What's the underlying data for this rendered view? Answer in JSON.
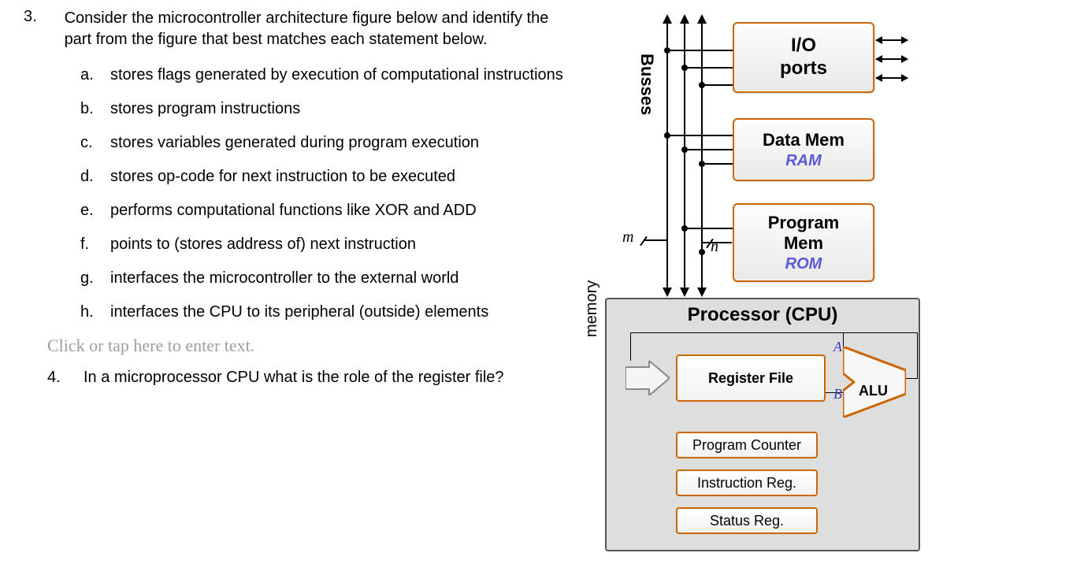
{
  "q3": {
    "number": "3.",
    "intro": "Consider the microcontroller architecture figure below and identify the part from the figure that best matches each statement below.",
    "items": [
      {
        "letter": "a.",
        "text": "stores flags generated by execution of computational instructions"
      },
      {
        "letter": "b.",
        "text": "stores program instructions"
      },
      {
        "letter": "c.",
        "text": "stores variables generated during program execution"
      },
      {
        "letter": "d.",
        "text": "stores op-code for next instruction to be executed"
      },
      {
        "letter": "e.",
        "text": "performs computational functions like XOR and ADD"
      },
      {
        "letter": "f.",
        "text": "points to (stores address of) next instruction"
      },
      {
        "letter": "g.",
        "text": "interfaces the microcontroller to the external world"
      },
      {
        "letter": "h.",
        "text": "interfaces the CPU to its peripheral (outside) elements"
      }
    ]
  },
  "placeholder": "Click or tap here to enter text.",
  "q4": {
    "number": "4.",
    "text": "In a microprocessor CPU what is the role of the register file?"
  },
  "diagram": {
    "busses_label": "Busses",
    "memory_label": "memory",
    "m": "m",
    "n": "n",
    "io": {
      "line1": "I/O",
      "line2": "ports"
    },
    "data_mem": {
      "title": "Data Mem",
      "sub": "RAM"
    },
    "prog_mem": {
      "line1": "Program",
      "line2": "Mem",
      "sub": "ROM"
    },
    "cpu_title": "Processor (CPU)",
    "register_file": "Register File",
    "program_counter": "Program Counter",
    "instruction_reg": "Instruction Reg.",
    "status_reg": "Status Reg.",
    "alu": "ALU",
    "A": "A",
    "B": "B"
  }
}
